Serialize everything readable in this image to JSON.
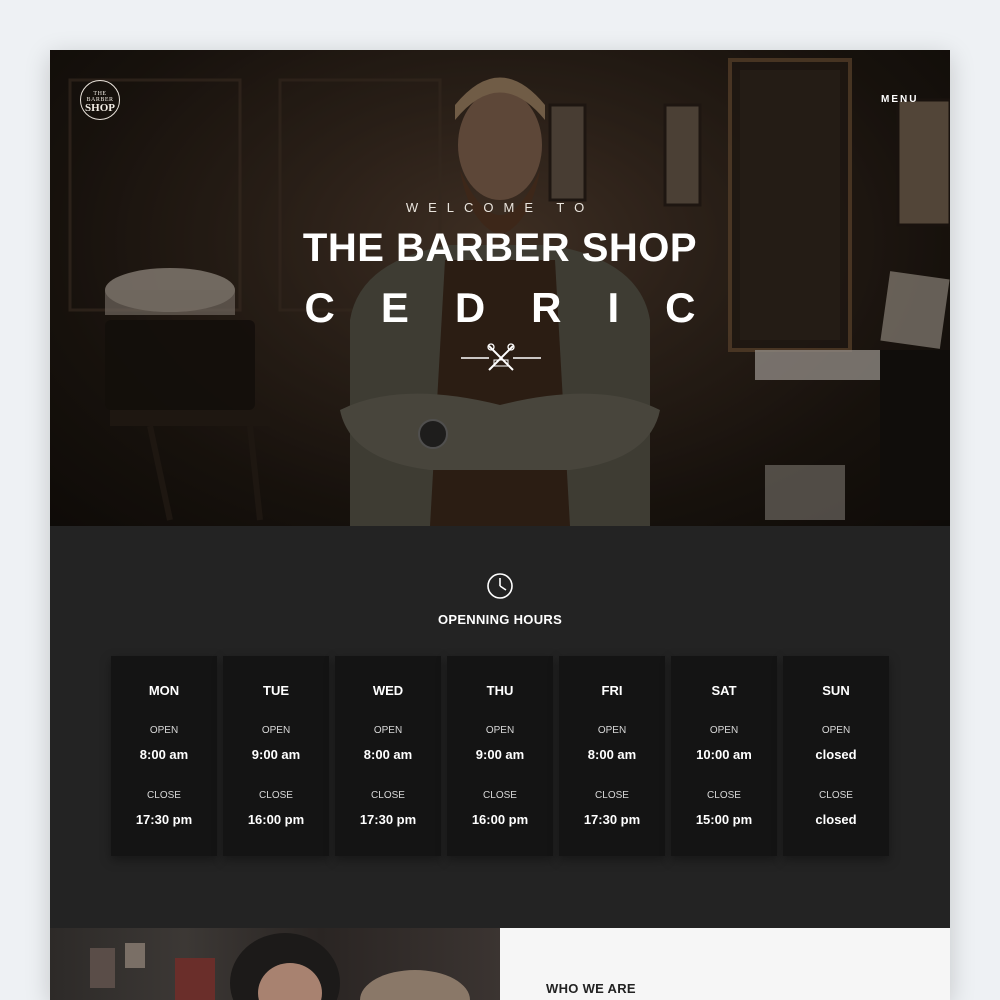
{
  "header": {
    "logo_top": "THE BARBER",
    "logo_main": "SHOP",
    "menu_label": "MENU"
  },
  "hero": {
    "welcome": "WELCOME TO",
    "title": "THE BARBER SHOP",
    "name": "CEDRIC"
  },
  "hours": {
    "title": "OPENNING HOURS",
    "open_label": "OPEN",
    "close_label": "CLOSE",
    "days": [
      {
        "day": "MON",
        "open": "8:00 am",
        "close": "17:30 pm"
      },
      {
        "day": "TUE",
        "open": "9:00 am",
        "close": "16:00 pm"
      },
      {
        "day": "WED",
        "open": "8:00 am",
        "close": "17:30 pm"
      },
      {
        "day": "THU",
        "open": "9:00 am",
        "close": "16:00 pm"
      },
      {
        "day": "FRI",
        "open": "8:00 am",
        "close": "17:30 pm"
      },
      {
        "day": "SAT",
        "open": "10:00 am",
        "close": "15:00 pm"
      },
      {
        "day": "SUN",
        "open": "closed",
        "close": "closed"
      }
    ]
  },
  "about": {
    "title": "WHO WE ARE"
  },
  "icons": {
    "clock": "clock-icon",
    "scissors": "scissors-comb-icon"
  },
  "colors": {
    "dark_section": "#232323",
    "card": "#141414",
    "light_section": "#f6f6f6",
    "page_bg": "#eef1f4"
  }
}
